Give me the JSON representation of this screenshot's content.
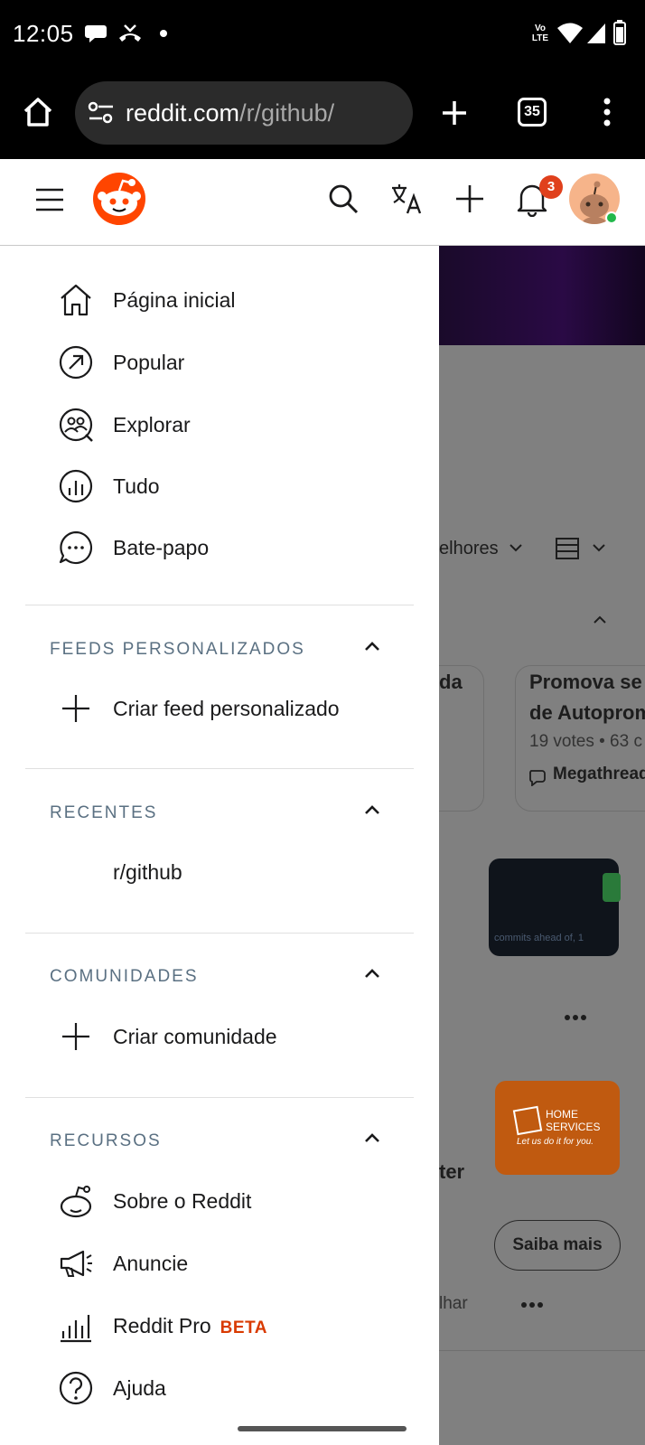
{
  "status_bar": {
    "time": "12:05",
    "network_label": "Vo LTE",
    "icons": [
      "chat-bubble-icon",
      "missed-call-icon",
      "dot-icon",
      "volte-icon",
      "wifi-icon",
      "signal-icon",
      "battery-icon"
    ]
  },
  "browser": {
    "url_host": "reddit.com",
    "url_path": "/r/github/",
    "tab_count": "35"
  },
  "header": {
    "notification_count": "3",
    "icons": [
      "menu-icon",
      "reddit-logo",
      "search-icon",
      "translate-icon",
      "plus-icon",
      "bell-icon",
      "avatar"
    ]
  },
  "drawer": {
    "main_items": [
      {
        "label": "Página inicial",
        "icon": "home-icon"
      },
      {
        "label": "Popular",
        "icon": "popular-icon"
      },
      {
        "label": "Explorar",
        "icon": "explore-icon"
      },
      {
        "label": "Tudo",
        "icon": "all-icon"
      },
      {
        "label": "Bate-papo",
        "icon": "chat-icon"
      }
    ],
    "sections": {
      "custom_feeds": {
        "title": "FEEDS PERSONALIZADOS",
        "item": "Criar feed personalizado"
      },
      "recent": {
        "title": "RECENTES",
        "item": "r/github"
      },
      "communities": {
        "title": "COMUNIDADES",
        "item": "Criar comunidade"
      },
      "resources": {
        "title": "RECURSOS",
        "items": [
          {
            "label": "Sobre o Reddit",
            "icon": "reddit-alien-icon"
          },
          {
            "label": "Anuncie",
            "icon": "megaphone-icon"
          },
          {
            "label": "Reddit Pro",
            "icon": "bar-chart-icon",
            "badge": "BETA"
          },
          {
            "label": "Ajuda",
            "icon": "help-icon"
          }
        ]
      }
    }
  },
  "background": {
    "sort_label": "elhores",
    "card1_title": "da",
    "card2_title_1": "Promova se",
    "card2_title_2": "de Autoprom",
    "card2_meta": "19 votes • 63 c",
    "card2_tag": "Megathread",
    "thumb_caption": "commits ahead of, 1",
    "ad_brand_line1": "HOME",
    "ad_brand_line2": "SERVICES",
    "ad_tagline": "Let us do it for you.",
    "ad_title_fragment": "ter",
    "learn_more": "Saiba mais",
    "share_fragment": "lhar"
  },
  "colors": {
    "reddit_orange": "#ff4500",
    "badge_red": "#e0401c",
    "beta_orange": "#d93a00",
    "section_gray": "#5a7082",
    "online_green": "#22b84b"
  }
}
